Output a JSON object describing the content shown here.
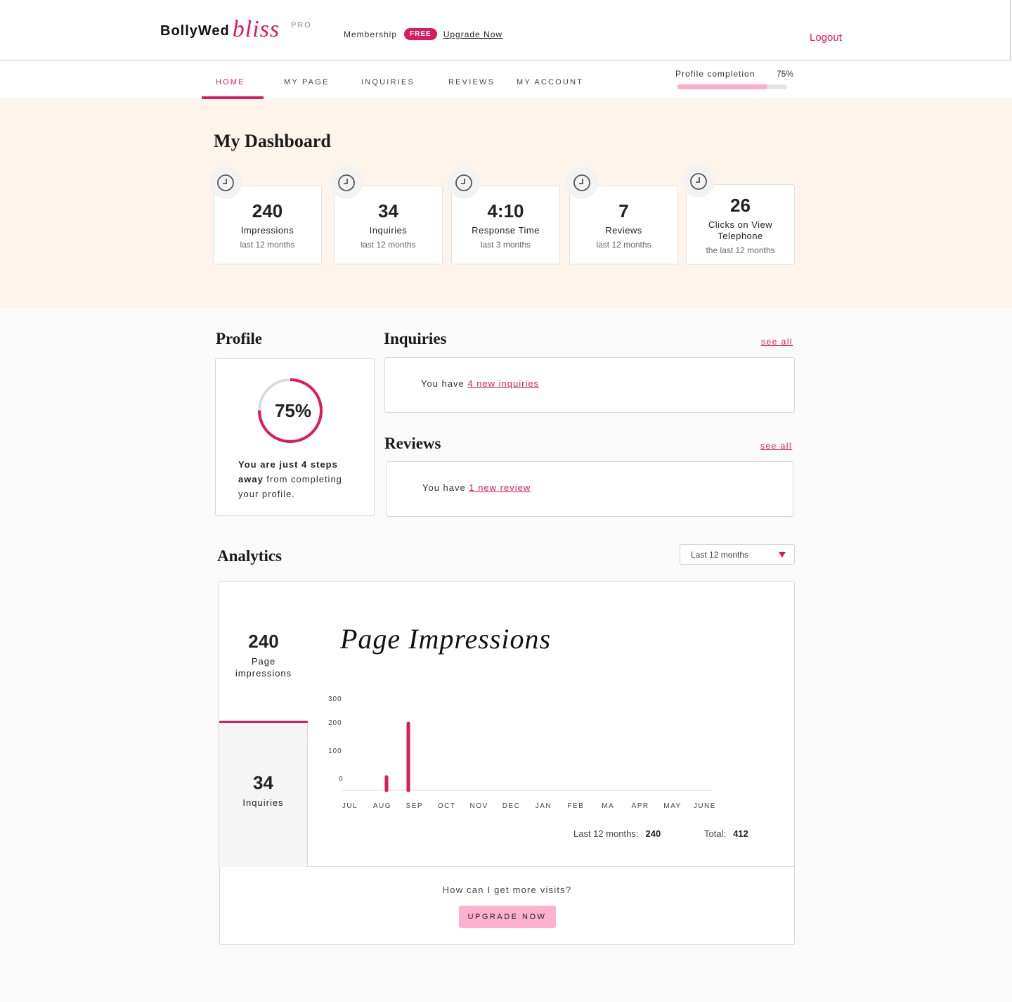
{
  "header": {
    "logo_word": "BollyWed",
    "logo_script": "bliss",
    "logo_tier": "PRO",
    "membership_label": "Membership",
    "membership_badge": "FREE",
    "upgrade_link": "Upgrade Now",
    "logout": "Logout"
  },
  "nav": {
    "items": [
      {
        "label": "HOME",
        "active": true
      },
      {
        "label": "MY PAGE"
      },
      {
        "label": "INQUIRIES"
      },
      {
        "label": "REVIEWS"
      },
      {
        "label": "MY ACCOUNT"
      }
    ],
    "profile_completion_label": "Profile completion",
    "profile_completion_value": "75%",
    "profile_completion_fraction": 0.82
  },
  "dashboard": {
    "title": "My Dashboard",
    "stats": [
      {
        "icon": "clock-icon",
        "value": "240",
        "label": "Impressions",
        "sub": "last 12 months"
      },
      {
        "icon": "clock-icon",
        "value": "34",
        "label": "Inquiries",
        "sub": "last 12 months"
      },
      {
        "icon": "clock-icon",
        "value": "4:10",
        "label": "Response Time",
        "sub": "last 3 months"
      },
      {
        "icon": "clock-icon",
        "value": "7",
        "label": "Reviews",
        "sub": "last 12 months"
      },
      {
        "icon": "clock-icon",
        "value": "26",
        "label": "Clicks on View Telephone",
        "sub": "the last 12 months"
      }
    ]
  },
  "profile": {
    "title": "Profile",
    "percent_text": "75%",
    "percent": 75,
    "msg_bold": "You are just 4 steps away",
    "msg_rest": " from completing your profile."
  },
  "inquiries": {
    "title": "Inquiries",
    "see_all": "see all",
    "msg_prefix": "You have ",
    "msg_link": "4 new inquiries"
  },
  "reviews": {
    "title": "Reviews",
    "see_all": "see all",
    "msg_prefix": "You have ",
    "msg_link": "1 new review"
  },
  "analytics": {
    "title": "Analytics",
    "range_selected": "Last 12 months",
    "tabs": [
      {
        "value": "240",
        "label": "Page impressions",
        "active": true
      },
      {
        "value": "34",
        "label": "Inquiries",
        "active": false
      }
    ],
    "chart_title": "Page Impressions",
    "last12_label": "Last 12 months:",
    "last12_value": "240",
    "total_label": "Total:",
    "total_value": "412",
    "cta_question": "How can I get more visits?",
    "cta_button": "UPGRADE NOW"
  },
  "chart_data": {
    "type": "bar",
    "title": "Page Impressions",
    "categories": [
      "JUL",
      "AUG",
      "SEP",
      "OCT",
      "NOV",
      "DEC",
      "JAN",
      "FEB",
      "MA",
      "APR",
      "MAY",
      "JUNE"
    ],
    "values": [
      0,
      40,
      200,
      0,
      0,
      0,
      0,
      0,
      0,
      0,
      0,
      0
    ],
    "yticks": [
      0,
      100,
      200,
      300
    ],
    "ylim": [
      0,
      300
    ],
    "xlabel": "",
    "ylabel": "",
    "grid": false,
    "color": "#e0185f"
  },
  "colors": {
    "accent": "#e0185f",
    "accent_light": "#ffb0cf",
    "dashboard_bg": "#fdf4ec"
  }
}
